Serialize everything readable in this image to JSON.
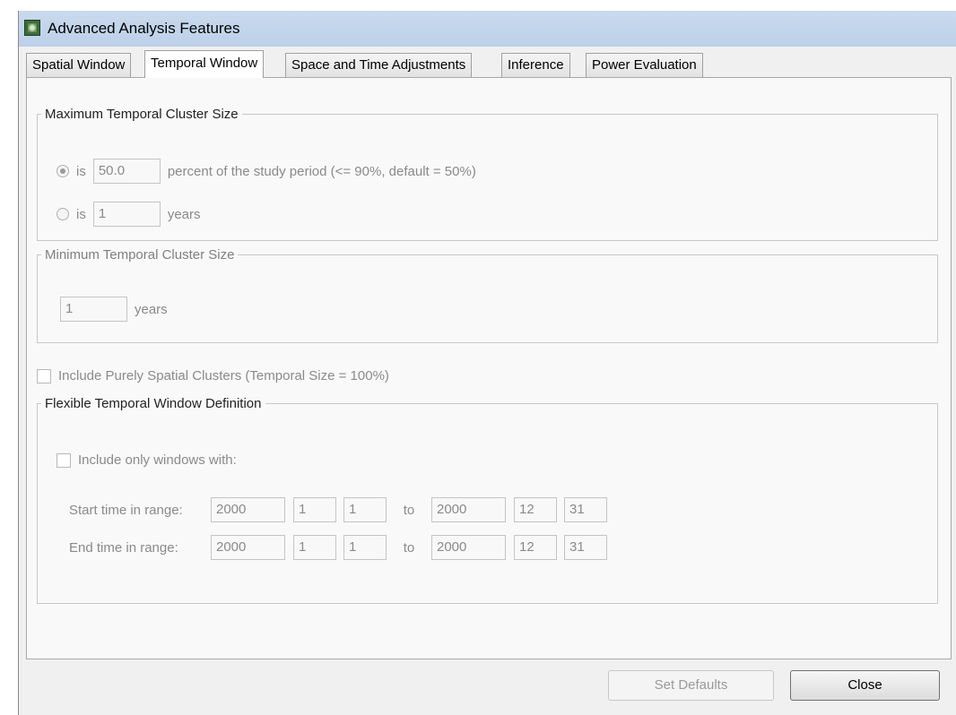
{
  "window": {
    "title": "Advanced Analysis Features",
    "icon": "app-globe-icon"
  },
  "tabs": [
    {
      "label": "Spatial Window",
      "active": false
    },
    {
      "label": "Temporal Window",
      "active": true
    },
    {
      "label": "Space and Time Adjustments",
      "active": false
    },
    {
      "label": "Inference",
      "active": false
    },
    {
      "label": "Power Evaluation",
      "active": false
    }
  ],
  "max_cluster": {
    "legend": "Maximum Temporal Cluster Size",
    "option_percent": {
      "prefix": "is",
      "value": "50.0",
      "suffix": "percent of the study period (<= 90%, default = 50%)",
      "selected": true
    },
    "option_years": {
      "prefix": "is",
      "value": "1",
      "suffix": "years",
      "selected": false
    }
  },
  "min_cluster": {
    "legend": "Minimum Temporal Cluster Size",
    "value": "1",
    "suffix": "years"
  },
  "purely_spatial": {
    "label": "Include Purely Spatial Clusters (Temporal Size = 100%)",
    "checked": false
  },
  "flexible": {
    "legend": "Flexible Temporal Window Definition",
    "include_label": "Include only windows with:",
    "include_checked": false,
    "start": {
      "label": "Start time in range:",
      "from": [
        "2000",
        "1",
        "1"
      ],
      "to_label": "to",
      "to": [
        "2000",
        "12",
        "31"
      ]
    },
    "end": {
      "label": "End time in range:",
      "from": [
        "2000",
        "1",
        "1"
      ],
      "to_label": "to",
      "to": [
        "2000",
        "12",
        "31"
      ]
    }
  },
  "buttons": {
    "set_defaults": "Set Defaults",
    "close": "Close"
  }
}
